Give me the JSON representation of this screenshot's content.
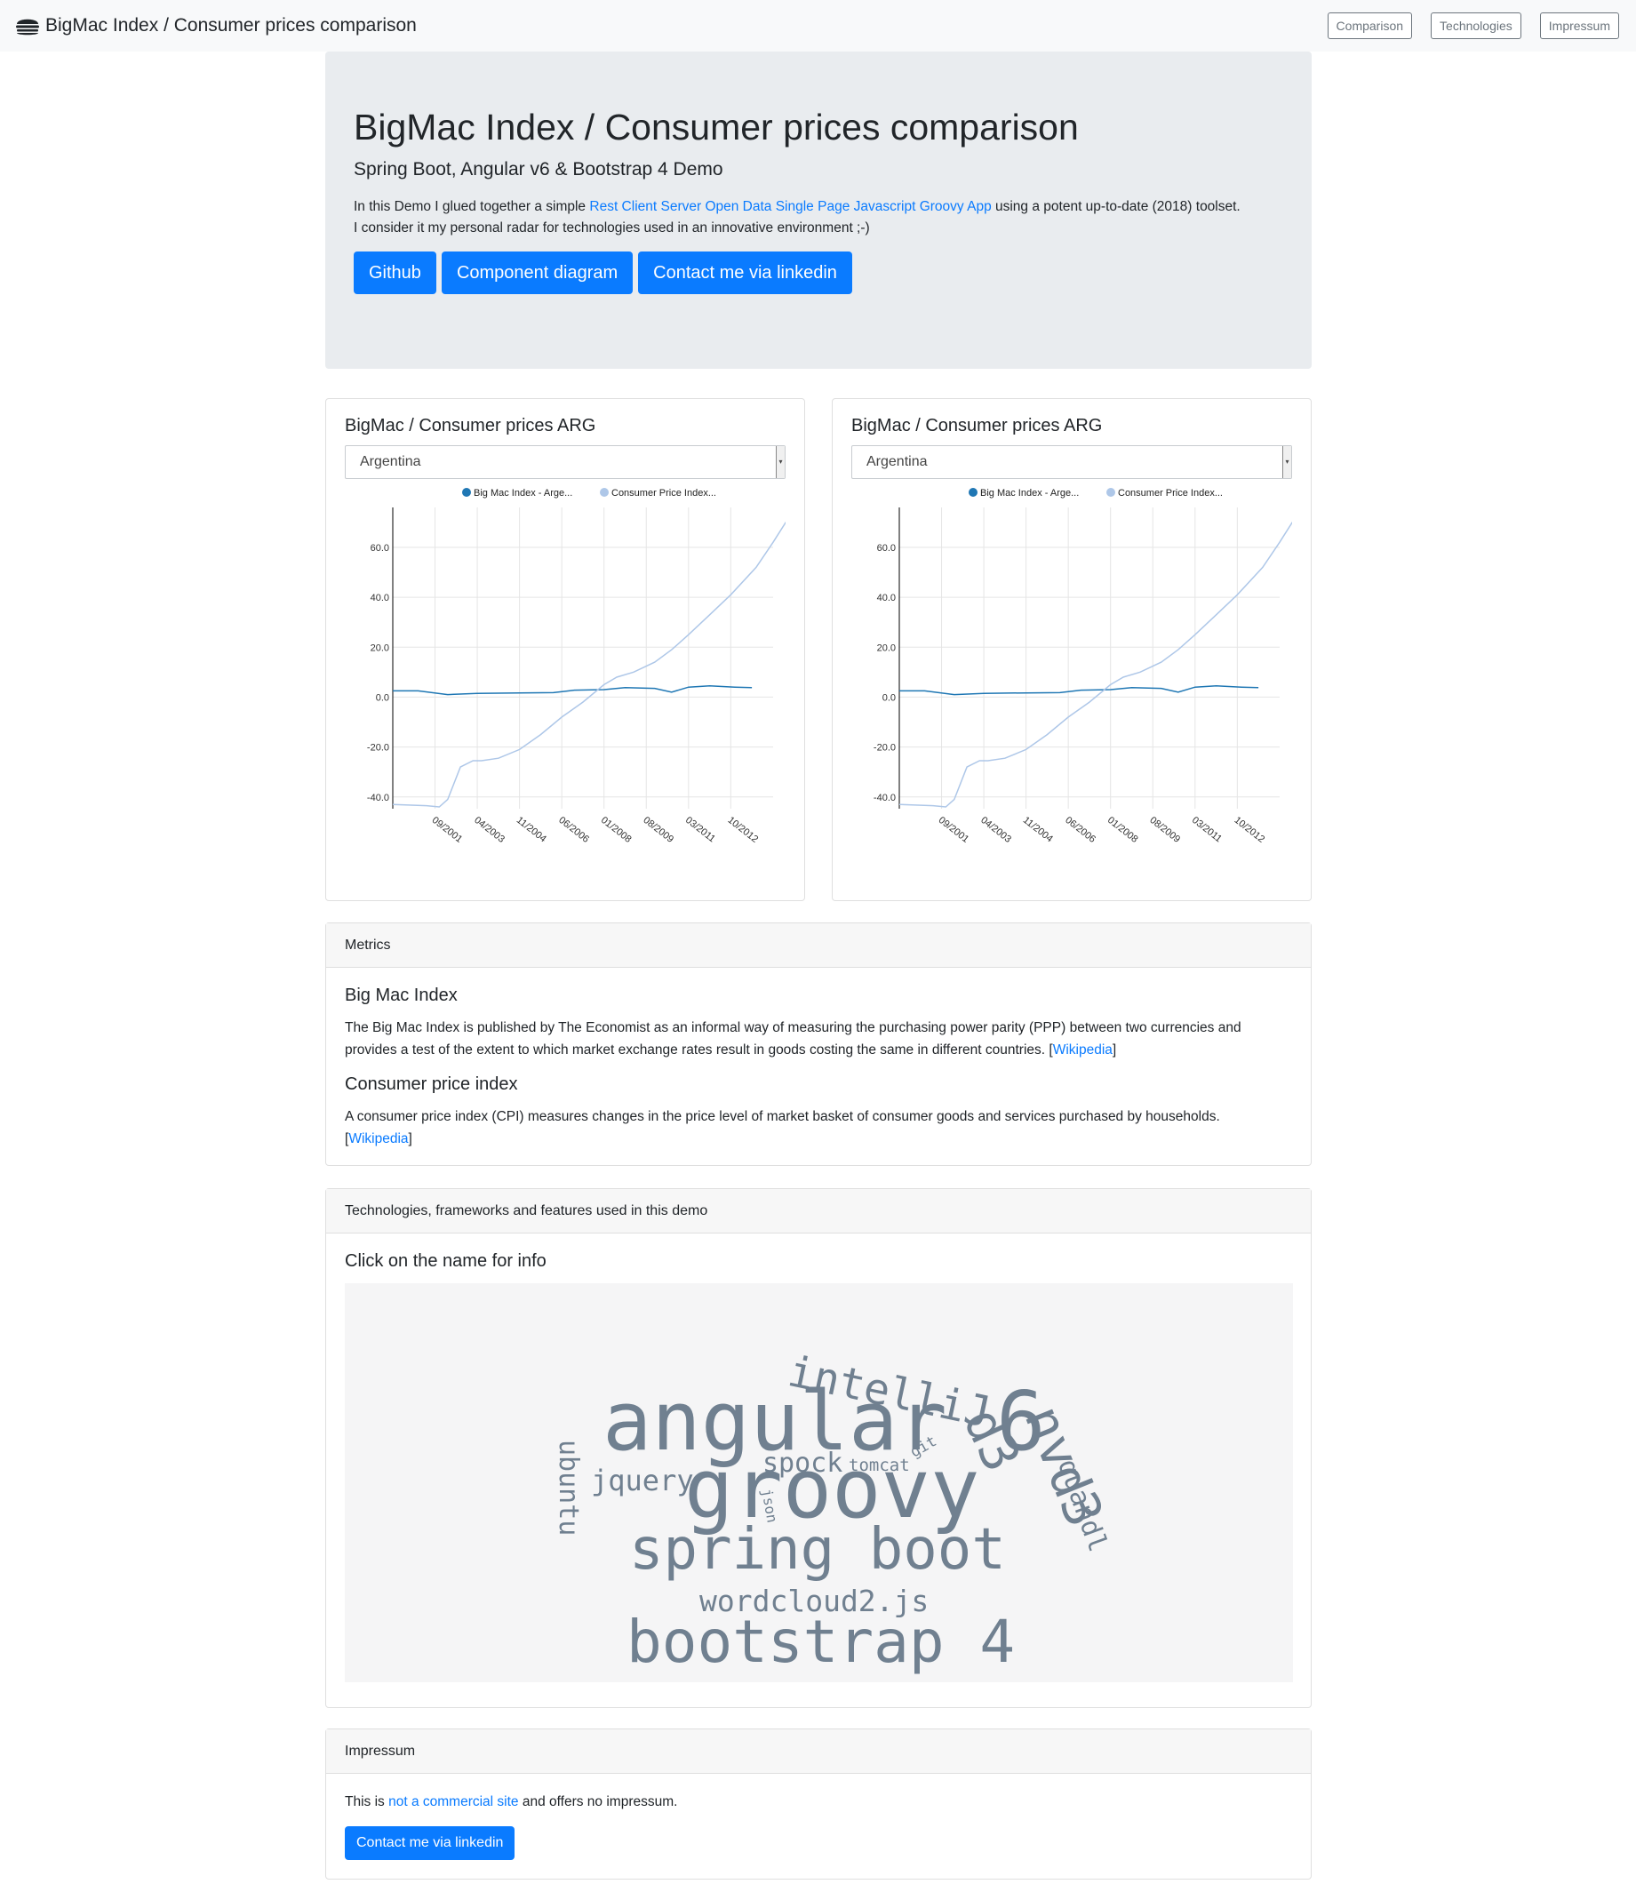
{
  "navbar": {
    "brand": "BigMac Index / Consumer prices comparison",
    "links": [
      "Comparison",
      "Technologies",
      "Impressum"
    ]
  },
  "jumbotron": {
    "title": "BigMac Index / Consumer prices comparison",
    "subtitle": "Spring Boot, Angular v6 & Bootstrap 4 Demo",
    "text_before": "In this Demo I glued together a simple ",
    "link_text": "Rest Client Server Open Data Single Page Javascript Groovy App",
    "text_after": " using a potent up-to-date (2018) toolset.",
    "line2": "I consider it my personal radar for technologies used in an innovative environment ;-)",
    "buttons": [
      "Github",
      "Component diagram",
      "Contact me via linkedin"
    ]
  },
  "charts_panel": [
    {
      "title": "BigMac / Consumer prices ARG",
      "selected_country": "Argentina"
    },
    {
      "title": "BigMac / Consumer prices ARG",
      "selected_country": "Argentina"
    }
  ],
  "chart_data": [
    {
      "type": "line",
      "legend": [
        "Big Mac Index - Arge...",
        "Consumer Price Index..."
      ],
      "legend_position": "top",
      "x_ticks": [
        "09/2001",
        "04/2003",
        "11/2004",
        "06/2006",
        "01/2008",
        "08/2009",
        "03/2011",
        "10/2012"
      ],
      "y_ticks": [
        "60.0",
        "40.0",
        "20.0",
        "0.0",
        "-20.0",
        "-40.0"
      ],
      "ylim": [
        -44,
        76
      ],
      "xlim": [
        0,
        8.75
      ],
      "grid": true,
      "series": [
        {
          "name": "Big Mac Index - Arge...",
          "color": "#1f77b4",
          "points": [
            [
              0,
              2.5
            ],
            [
              0.6,
              2.5
            ],
            [
              1.3,
              1.0
            ],
            [
              2,
              1.5
            ],
            [
              3,
              1.7
            ],
            [
              3.8,
              1.8
            ],
            [
              4.3,
              2.8
            ],
            [
              5,
              3.0
            ],
            [
              5.5,
              3.8
            ],
            [
              6.2,
              3.5
            ],
            [
              6.6,
              2.0
            ],
            [
              7,
              4.0
            ],
            [
              7.5,
              4.5
            ],
            [
              8.1,
              4.0
            ],
            [
              8.5,
              3.8
            ]
          ]
        },
        {
          "name": "Consumer Price Index...",
          "color": "#aec7e8",
          "points": [
            [
              0,
              -43
            ],
            [
              0.8,
              -43.5
            ],
            [
              1.1,
              -44
            ],
            [
              1.3,
              -41
            ],
            [
              1.6,
              -28
            ],
            [
              1.9,
              -25.5
            ],
            [
              2.1,
              -25.5
            ],
            [
              2.5,
              -24.5
            ],
            [
              3,
              -21
            ],
            [
              3.5,
              -15
            ],
            [
              4,
              -8
            ],
            [
              4.5,
              -2
            ],
            [
              5,
              5
            ],
            [
              5.3,
              8
            ],
            [
              5.7,
              10
            ],
            [
              6.2,
              14
            ],
            [
              6.6,
              19
            ],
            [
              7,
              25
            ],
            [
              7.5,
              33
            ],
            [
              8,
              41
            ],
            [
              8.6,
              52
            ],
            [
              9,
              62
            ],
            [
              9.3,
              70
            ],
            [
              9.6,
              76
            ]
          ]
        }
      ]
    },
    {
      "type": "line",
      "legend": [
        "Big Mac Index - Arge...",
        "Consumer Price Index..."
      ],
      "legend_position": "top",
      "x_ticks": [
        "09/2001",
        "04/2003",
        "11/2004",
        "06/2006",
        "01/2008",
        "08/2009",
        "03/2011",
        "10/2012"
      ],
      "y_ticks": [
        "60.0",
        "40.0",
        "20.0",
        "0.0",
        "-20.0",
        "-40.0"
      ],
      "ylim": [
        -44,
        76
      ],
      "xlim": [
        0,
        8.75
      ],
      "grid": true,
      "series": [
        {
          "name": "Big Mac Index - Arge...",
          "color": "#1f77b4",
          "points": [
            [
              0,
              2.5
            ],
            [
              0.6,
              2.5
            ],
            [
              1.3,
              1.0
            ],
            [
              2,
              1.5
            ],
            [
              3,
              1.7
            ],
            [
              3.8,
              1.8
            ],
            [
              4.3,
              2.8
            ],
            [
              5,
              3.0
            ],
            [
              5.5,
              3.8
            ],
            [
              6.2,
              3.5
            ],
            [
              6.6,
              2.0
            ],
            [
              7,
              4.0
            ],
            [
              7.5,
              4.5
            ],
            [
              8.1,
              4.0
            ],
            [
              8.5,
              3.8
            ]
          ]
        },
        {
          "name": "Consumer Price Index...",
          "color": "#aec7e8",
          "points": [
            [
              0,
              -43
            ],
            [
              0.8,
              -43.5
            ],
            [
              1.1,
              -44
            ],
            [
              1.3,
              -41
            ],
            [
              1.6,
              -28
            ],
            [
              1.9,
              -25.5
            ],
            [
              2.1,
              -25.5
            ],
            [
              2.5,
              -24.5
            ],
            [
              3,
              -21
            ],
            [
              3.5,
              -15
            ],
            [
              4,
              -8
            ],
            [
              4.5,
              -2
            ],
            [
              5,
              5
            ],
            [
              5.3,
              8
            ],
            [
              5.7,
              10
            ],
            [
              6.2,
              14
            ],
            [
              6.6,
              19
            ],
            [
              7,
              25
            ],
            [
              7.5,
              33
            ],
            [
              8,
              41
            ],
            [
              8.6,
              52
            ],
            [
              9,
              62
            ],
            [
              9.3,
              70
            ],
            [
              9.6,
              76
            ]
          ]
        }
      ]
    }
  ],
  "metrics": {
    "header": "Metrics",
    "bigmac_title": "Big Mac Index",
    "bigmac_text": "The Big Mac Index is published by The Economist as an informal way of measuring the purchasing power parity (PPP) between two currencies and provides a test of the extent to which market exchange rates result in goods costing the same in different countries. ",
    "cpi_title": "Consumer price index",
    "cpi_text": "A consumer price index (CPI) measures changes in the price level of market basket of consumer goods and services purchased by households. ",
    "wiki_label": "Wikipedia",
    "bracket_open": "[",
    "bracket_close": "]"
  },
  "technologies": {
    "header": "Technologies, frameworks and features used in this demo",
    "title": "Click on the name for info",
    "word_color": "#708090",
    "words": [
      "intelliJ",
      "angular 6",
      "d3",
      "nvd3",
      "quandl",
      "ubuntu",
      "jquery",
      "spock",
      "tomcat",
      "git",
      "json",
      "groovy",
      "spring boot",
      "wordcloud2.js",
      "bootstrap 4"
    ]
  },
  "impressum": {
    "header": "Impressum",
    "text_before": "This is ",
    "link_text": "not a commercial site",
    "text_after": " and offers no impressum.",
    "button": "Contact me via linkedin"
  },
  "icons": {
    "brand": "burger-icon"
  }
}
